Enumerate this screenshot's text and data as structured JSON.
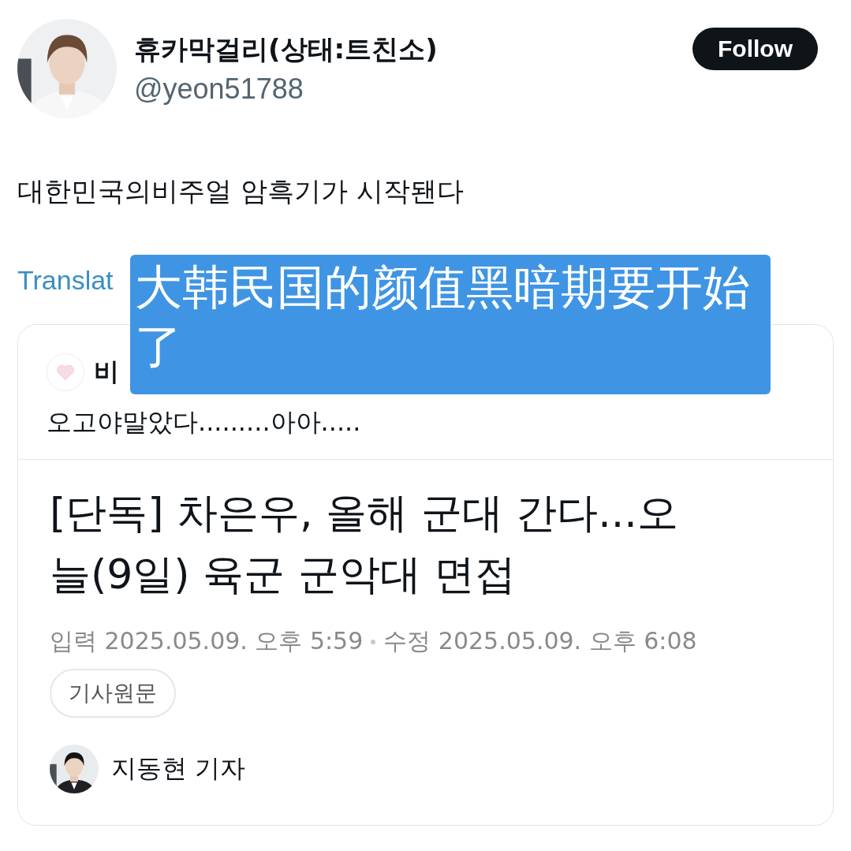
{
  "author": {
    "name": "휴카막걸리(상태:트친소)",
    "handle": "@yeon51788"
  },
  "follow_button": "Follow",
  "tweet_text": "대한민국의비주얼 암흑기가 시작됀다",
  "translate_link": "Translat",
  "quoted_tweet": {
    "author_name": "비",
    "text": "오고야말았다.........아아.....",
    "article": {
      "headline": "[단독] 차은우, 올해 군대 간다...오늘(9일) 육군 군악대 면접",
      "published": "입력 2025.05.09. 오후 5:59",
      "edited": "수정 2025.05.09. 오후 6:08",
      "source_button": "기사원문",
      "reporter": "지동현 기자"
    }
  },
  "caption_overlay": "大韩民国的颜值黑暗期要开始了"
}
